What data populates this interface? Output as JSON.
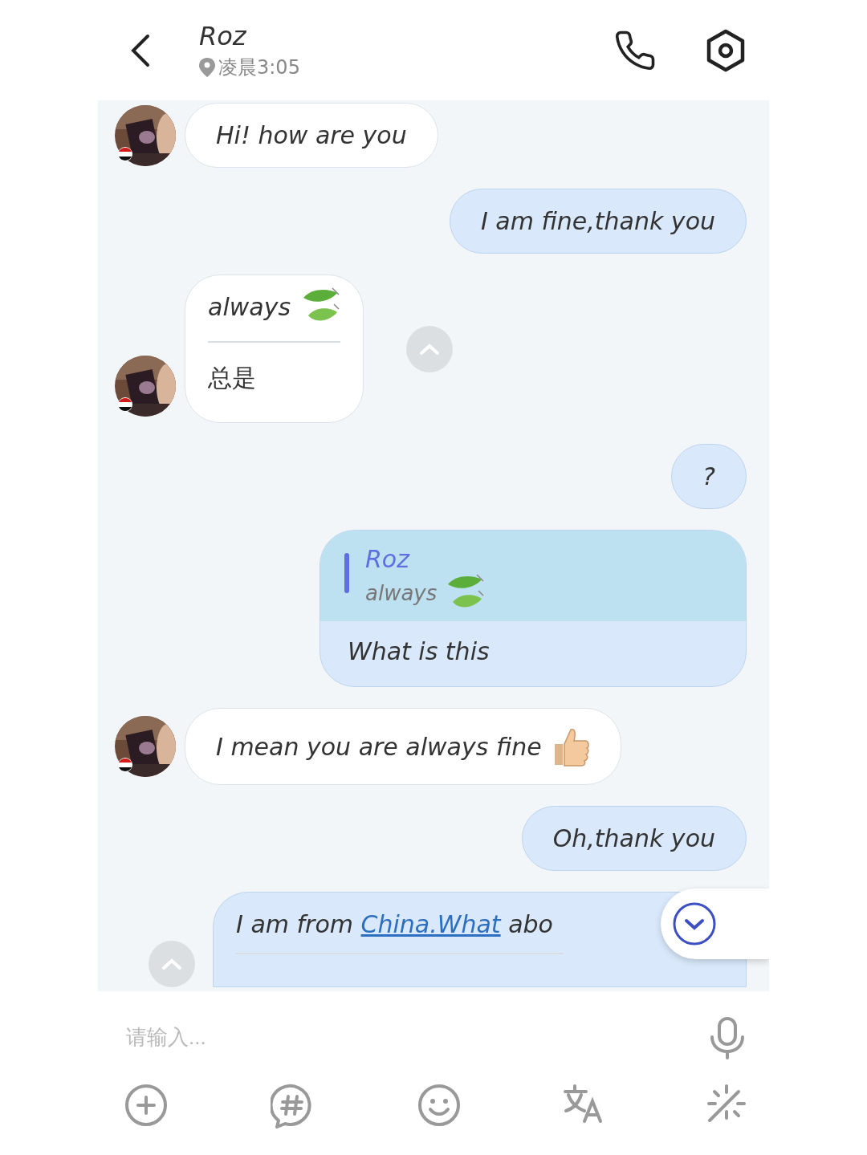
{
  "header": {
    "name": "Roz",
    "status": "凌晨3:05"
  },
  "messages": [
    {
      "kind": "text",
      "outgoing": false,
      "text": "Hi! how are you"
    },
    {
      "kind": "text",
      "outgoing": true,
      "text": "I am fine,thank you"
    },
    {
      "kind": "translated",
      "outgoing": false,
      "text": "always",
      "translation": "总是",
      "leaf_icon": true
    },
    {
      "kind": "text",
      "outgoing": true,
      "text": "?"
    },
    {
      "kind": "reply",
      "outgoing": true,
      "quote_author": "Roz",
      "quote_text": "always",
      "quote_leaf_icon": true,
      "text": "What is this"
    },
    {
      "kind": "text",
      "outgoing": false,
      "text": "I mean you are always fine",
      "thumb_icon": true
    },
    {
      "kind": "text",
      "outgoing": true,
      "text": "Oh,thank you"
    },
    {
      "kind": "linked",
      "outgoing": true,
      "text": "I am from ",
      "link": "China.What",
      "tail": " abo"
    }
  ],
  "input": {
    "placeholder": "请输入..."
  }
}
